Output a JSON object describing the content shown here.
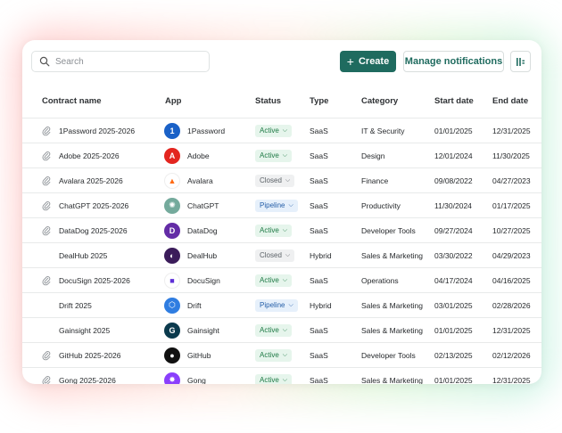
{
  "search": {
    "placeholder": "Search"
  },
  "toolbar": {
    "create_label": "Create",
    "create_icon": "plus-icon",
    "manage_label": "Manage notifications",
    "columns_icon": "columns-settings-icon"
  },
  "columns": [
    "Contract name",
    "App",
    "Status",
    "Type",
    "Category",
    "Start date",
    "End date"
  ],
  "colors": {
    "accent": "#1f6b5f",
    "active_bg": "#e6f5ec",
    "active_fg": "#1e7a45",
    "closed_bg": "#eff0f1",
    "closed_fg": "#5b6167",
    "pipeline_bg": "#e6f0fb",
    "pipeline_fg": "#245ea8"
  },
  "rows": [
    {
      "contract": "1Password 2025-2026",
      "has_attachment": true,
      "app": "1Password",
      "logo_color": "#1a61c7",
      "logo_glyph": "1",
      "status": "Active",
      "type": "SaaS",
      "category": "IT & Security",
      "start": "01/01/2025",
      "end": "12/31/2025"
    },
    {
      "contract": "Adobe  2025-2026",
      "has_attachment": true,
      "app": "Adobe",
      "logo_color": "#e3251f",
      "logo_glyph": "A",
      "status": "Active",
      "type": "SaaS",
      "category": "Design",
      "start": "12/01/2024",
      "end": "11/30/2025"
    },
    {
      "contract": "Avalara 2025-2026",
      "has_attachment": true,
      "app": "Avalara",
      "logo_color": "#ffffff",
      "logo_glyph": "▲",
      "status": "Closed",
      "type": "SaaS",
      "category": "Finance",
      "start": "09/08/2022",
      "end": "04/27/2023"
    },
    {
      "contract": "ChatGPT  2025-2026",
      "has_attachment": true,
      "app": "ChatGPT",
      "logo_color": "#74aa9c",
      "logo_glyph": "✺",
      "status": "Pipeline",
      "type": "SaaS",
      "category": "Productivity",
      "start": "11/30/2024",
      "end": "01/17/2025"
    },
    {
      "contract": "DataDog  2025-2026",
      "has_attachment": true,
      "app": "DataDog",
      "logo_color": "#632ca6",
      "logo_glyph": "D",
      "status": "Active",
      "type": "SaaS",
      "category": "Developer Tools",
      "start": "09/27/2024",
      "end": "10/27/2025"
    },
    {
      "contract": "DealHub  2025",
      "has_attachment": false,
      "app": "DealHub",
      "logo_color": "#3b1c5a",
      "logo_glyph": "◐",
      "status": "Closed",
      "type": "Hybrid",
      "category": "Sales & Marketing",
      "start": "03/30/2022",
      "end": "04/29/2023"
    },
    {
      "contract": "DocuSign  2025-2026",
      "has_attachment": true,
      "app": "DocuSign",
      "logo_color": "#ffffff",
      "logo_glyph": "■",
      "status": "Active",
      "type": "SaaS",
      "category": "Operations",
      "start": "04/17/2024",
      "end": "04/16/2025"
    },
    {
      "contract": "Drift  2025",
      "has_attachment": false,
      "app": "Drift",
      "logo_color": "#2f7de1",
      "logo_glyph": "⬡",
      "status": "Pipeline",
      "type": "Hybrid",
      "category": "Sales & Marketing",
      "start": "03/01/2025",
      "end": "02/28/2026"
    },
    {
      "contract": "Gainsight  2025",
      "has_attachment": false,
      "app": "Gainsight",
      "logo_color": "#0b3a4d",
      "logo_glyph": "G",
      "status": "Active",
      "type": "SaaS",
      "category": "Sales & Marketing",
      "start": "01/01/2025",
      "end": "12/31/2025"
    },
    {
      "contract": "GitHub  2025-2026",
      "has_attachment": true,
      "app": "GitHub",
      "logo_color": "#111111",
      "logo_glyph": "●",
      "status": "Active",
      "type": "SaaS",
      "category": "Developer Tools",
      "start": "02/13/2025",
      "end": "02/12/2026"
    },
    {
      "contract": "Gong  2025-2026",
      "has_attachment": true,
      "app": "Gong",
      "logo_color": "#8a3ffc",
      "logo_glyph": "✸",
      "status": "Active",
      "type": "SaaS",
      "category": "Sales & Marketing",
      "start": "01/01/2025",
      "end": "12/31/2025"
    }
  ]
}
